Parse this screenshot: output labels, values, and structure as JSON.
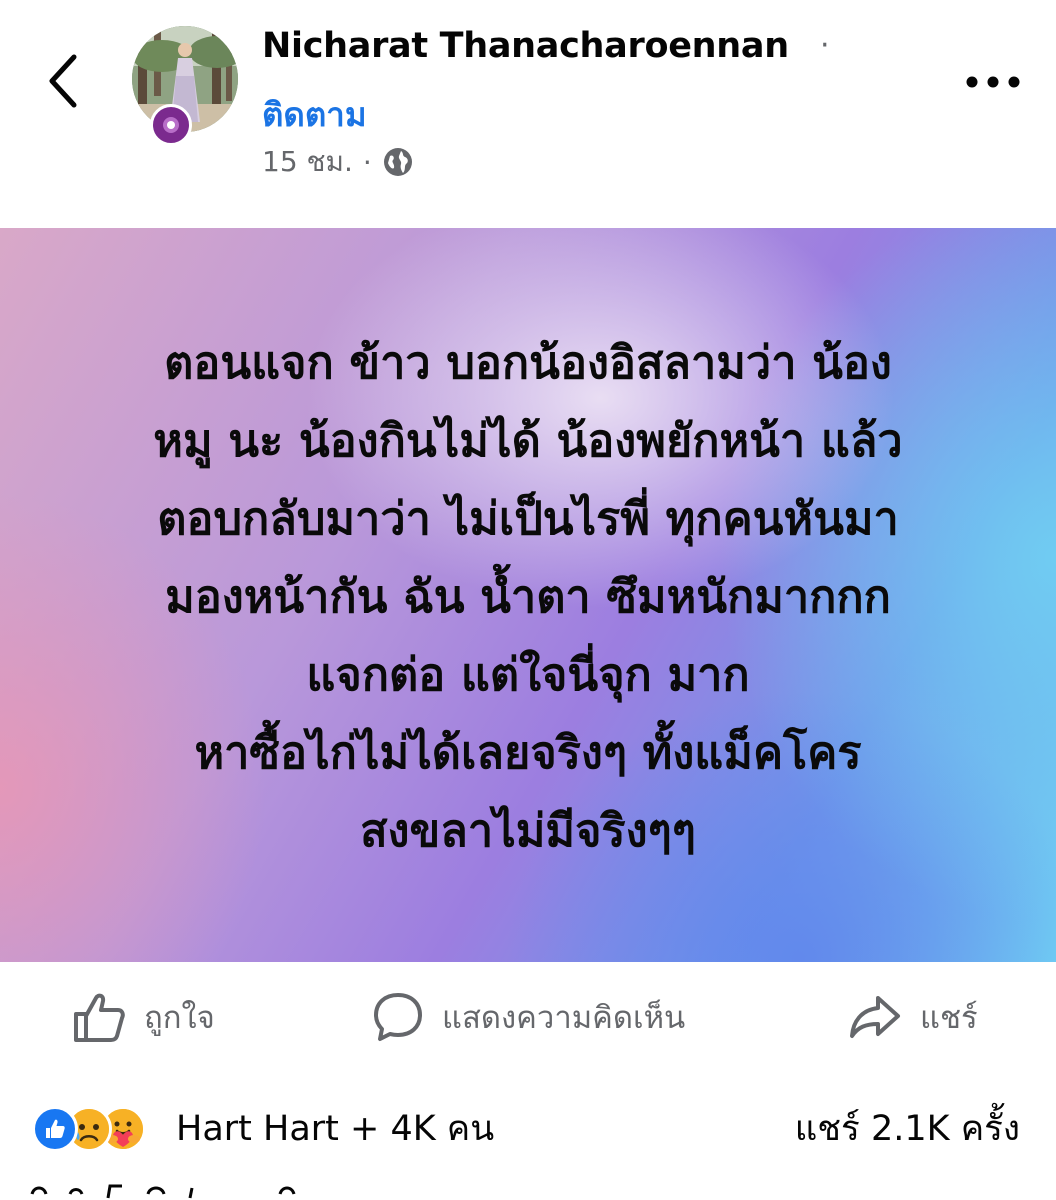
{
  "post": {
    "author": "Nicharat Thanacharoennan",
    "separator": "·",
    "follow_label": "ติดตาม",
    "time": "15 ชม.",
    "meta_dot": "·",
    "privacy_icon": "globe-icon",
    "text_lines": [
      "ตอนแจก ข้าว บอกน้องอิสลามว่า น้อง",
      "หมู นะ น้องกินไม่ได้ น้องพยักหน้า แล้ว",
      "ตอบกลับมาว่า ไม่เป็นไรพี่ ทุกคนหันมา",
      "มองหน้ากัน ฉัน น้ำตา ซึมหนักมากกก",
      "แจกต่อ แต่ใจนี่จุก มาก",
      "หาซื้อไก่ไม่ได้เลยจริงๆ  ทั้งแม็คโคร",
      "สงขลาไม่มีจริงๆๆ"
    ],
    "background_colors": [
      "#d9a8c8",
      "#b998da",
      "#9c7ee0",
      "#7196ea",
      "#70d2f4"
    ]
  },
  "actions": {
    "like_label": "ถูกใจ",
    "comment_label": "แสดงความคิดเห็น",
    "share_label": "แชร์"
  },
  "reactions": {
    "icons": [
      "like-icon",
      "sad-icon",
      "care-icon"
    ],
    "summary": "Hart Hart + 4K คน",
    "share_count": "แชร์ 2.1K ครั้ง"
  },
  "colors": {
    "link_blue": "#1b74e4",
    "muted_gray": "#65676b",
    "text": "#050505"
  }
}
